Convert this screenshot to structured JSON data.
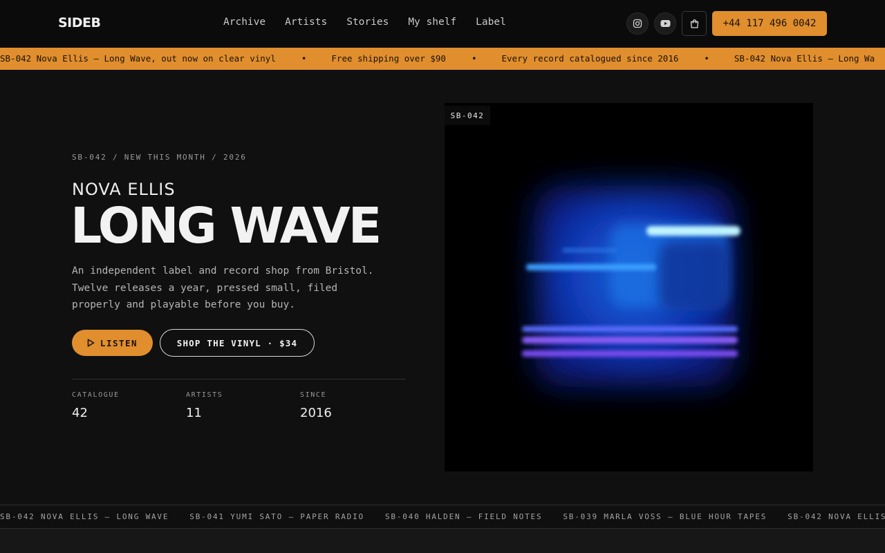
{
  "header": {
    "logo": "SIDEB",
    "nav": [
      "Archive",
      "Artists",
      "Stories",
      "My shelf",
      "Label"
    ],
    "icons": [
      "instagram-icon",
      "youtube-icon",
      "shopping-bag-icon"
    ],
    "phone": "+44 117 496 0042"
  },
  "promo": {
    "items": [
      "SB-042 Nova Ellis — Long Wave, out now on clear vinyl",
      "Free shipping over $90",
      "Every record catalogued since 2016",
      "SB-042 Nova Ellis — Long Wa"
    ],
    "separator": "•"
  },
  "hero": {
    "eyebrow": "SB-042 / NEW THIS MONTH / 2026",
    "artist": "NOVA ELLIS",
    "album": "LONG WAVE",
    "description": "An independent label and record shop from Bristol. Twelve releases a year, pressed small, filed properly and playable before you buy.",
    "listen_label": "LISTEN",
    "shop_label": "SHOP THE VINYL · $34",
    "stats": [
      {
        "label": "CATALOGUE",
        "value": "42"
      },
      {
        "label": "ARTISTS",
        "value": "11"
      },
      {
        "label": "SINCE",
        "value": "2016"
      }
    ],
    "cover_tag": "SB-042"
  },
  "catalog_strip": [
    "SB-042 NOVA ELLIS — LONG WAVE",
    "SB-041 YUMI SATO — PAPER RADIO",
    "SB-040 HALDEN — FIELD NOTES",
    "SB-039 MARLA VOSS — BLUE HOUR TAPES",
    "SB-042 NOVA ELLIS"
  ],
  "colors": {
    "accent": "#e08e2e",
    "background": "#101010",
    "header": "#0b0b0b"
  }
}
